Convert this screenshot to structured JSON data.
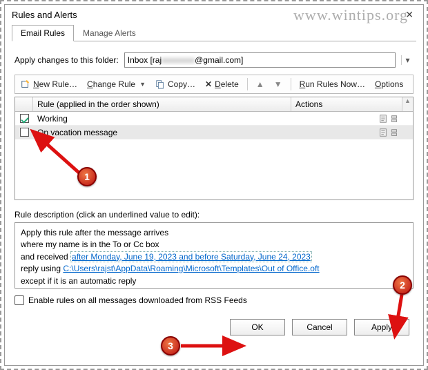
{
  "title": "Rules and Alerts",
  "watermark": "www.wintips.org",
  "tabs": {
    "email_rules": "Email Rules",
    "manage_alerts": "Manage Alerts"
  },
  "folder": {
    "label": "Apply changes to this folder:",
    "prefix": "Inbox [raj",
    "blurred": "xxxxxxxx",
    "suffix": "@gmail.com]"
  },
  "toolbar": {
    "new_rule": "New Rule…",
    "change_rule": "Change Rule",
    "copy": "Copy…",
    "delete": "Delete",
    "run_rules": "Run Rules Now…",
    "options": "Options"
  },
  "grid": {
    "header_rule": "Rule (applied in the order shown)",
    "header_actions": "Actions",
    "rows": [
      {
        "label": "Working",
        "checked": true,
        "selected": false
      },
      {
        "label": "On vacation message",
        "checked": false,
        "selected": true
      }
    ]
  },
  "description": {
    "label": "Rule description (click an underlined value to edit):",
    "line1": "Apply this rule after the message arrives",
    "line2": "where my name is in the To or Cc box",
    "line3_prefix": "  and received ",
    "line3_link": "after Monday, June 19, 2023 and before Saturday, June 24, 2023",
    "line4_prefix": "reply using ",
    "line4_link": "C:\\Users\\rajst\\AppData\\Roaming\\Microsoft\\Templates\\Out of Office.oft",
    "line5": "except if it is an automatic reply"
  },
  "rss_label": "Enable rules on all messages downloaded from RSS Feeds",
  "buttons": {
    "ok": "OK",
    "cancel": "Cancel",
    "apply": "Apply"
  },
  "annotations": {
    "b1": "1",
    "b2": "2",
    "b3": "3"
  }
}
